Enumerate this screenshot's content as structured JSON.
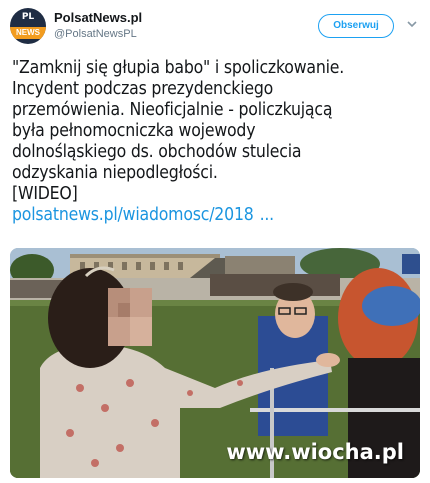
{
  "author": {
    "display_name": "PolsatNews.pl",
    "handle": "@PolsatNewsPL",
    "avatar_top": "PL",
    "avatar_bottom": "NEWS"
  },
  "actions": {
    "follow_label": "Obserwuj"
  },
  "tweet": {
    "lines": [
      "\"Zamknij się głupia babo\" i spoliczkowanie.",
      "Incydent podczas prezydenckiego",
      "przemówienia. Nieoficjalnie - policzkującą",
      "była pełnomocniczka wojewody",
      "dolnośląskiego ds. obchodów stulecia",
      "odzyskania niepodległości.",
      "[WIDEO]"
    ],
    "link": "polsatnews.pl/wiadomosc/2018",
    "ellipsis": "..."
  },
  "media": {
    "watermark": "www.wiocha.pl"
  },
  "colors": {
    "accent": "#1da1f2",
    "link": "#1b95e0",
    "muted": "#657786"
  }
}
